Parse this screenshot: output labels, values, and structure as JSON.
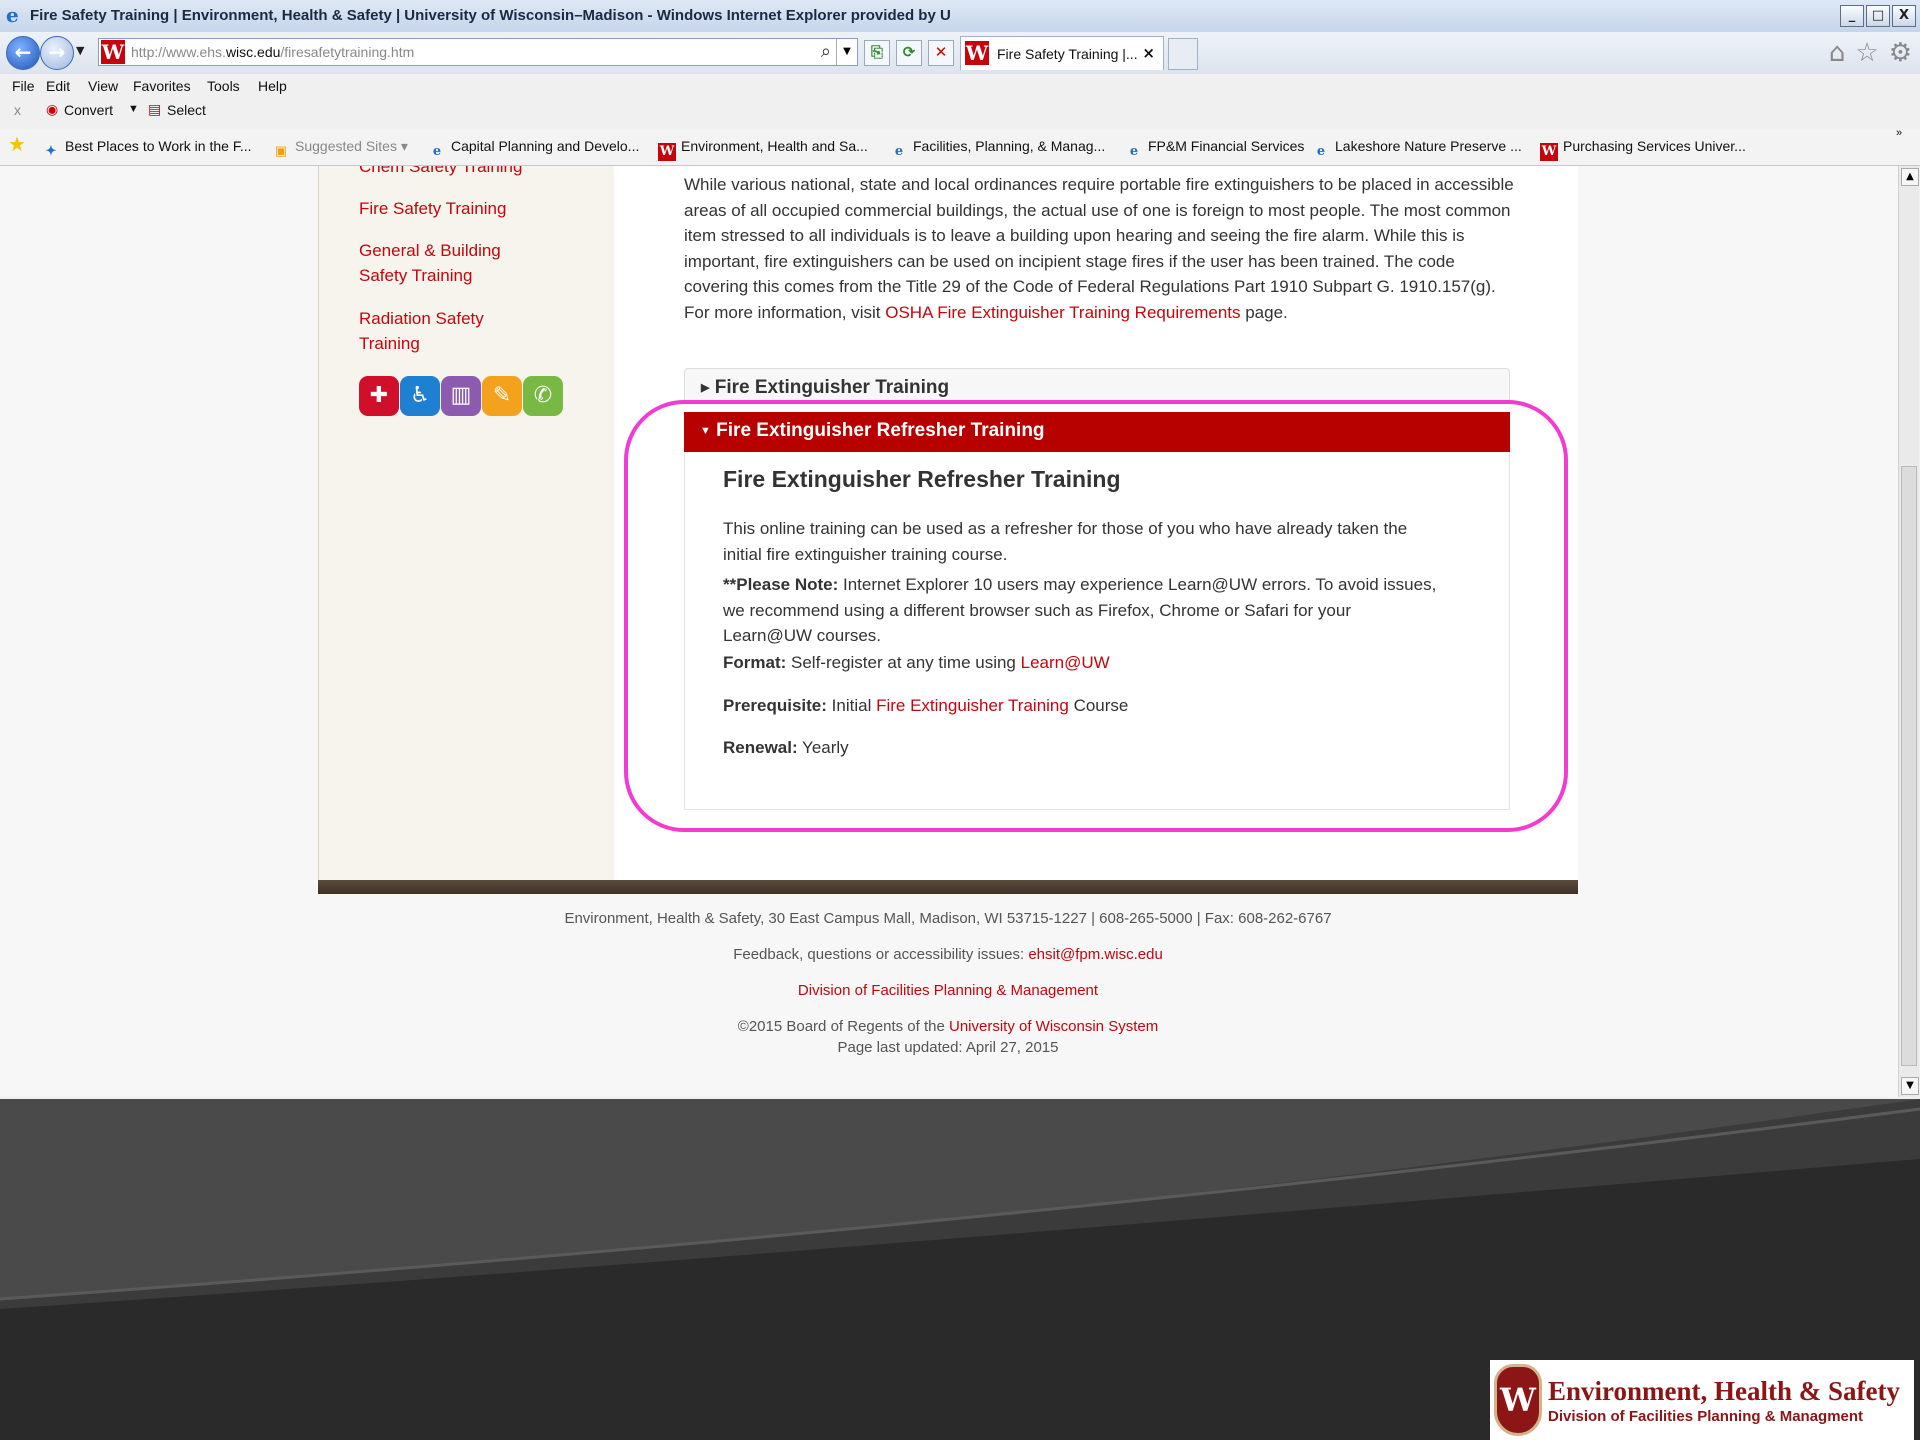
{
  "window": {
    "title": "Fire Safety Training | Environment, Health & Safety | University of Wisconsin–Madison - Windows Internet Explorer provided by U",
    "controls": [
      "_",
      "□",
      "X"
    ]
  },
  "address_bar": {
    "url_prefix": "http://www.ehs.",
    "url_domain": "wisc.edu",
    "url_path": "/firesafetytraining.htm"
  },
  "tab": {
    "title": "Fire Safety Training |...",
    "close": "×"
  },
  "menu": [
    "File",
    "Edit",
    "View",
    "Favorites",
    "Tools",
    "Help"
  ],
  "command_bar": {
    "close": "x",
    "convert": "Convert",
    "select": "Select"
  },
  "favorites": [
    {
      "icon": "ie",
      "label": "Best Places to Work in the F..."
    },
    {
      "icon": "sugg",
      "label": "Suggested Sites ▾"
    },
    {
      "icon": "ie",
      "label": "Capital Planning and Develo..."
    },
    {
      "icon": "w",
      "label": "Environment, Health and Sa..."
    },
    {
      "icon": "ie",
      "label": "Facilities, Planning, & Manag..."
    },
    {
      "icon": "ie",
      "label": "FP&M Financial Services"
    },
    {
      "icon": "ie",
      "label": "Lakeshore Nature Preserve ..."
    },
    {
      "icon": "w",
      "label": "Purchasing Services  Univer..."
    }
  ],
  "sidebar": {
    "links": [
      "Chem Safety Training",
      "Fire Safety Training",
      "General & Building Safety Training",
      "Radiation Safety Training"
    ],
    "quick_icons": [
      {
        "name": "first-aid-icon",
        "glyph": "✚",
        "color": "#d0102a"
      },
      {
        "name": "person-icon",
        "glyph": "♿",
        "color": "#1f7fd0"
      },
      {
        "name": "trash-icon",
        "glyph": "🗑",
        "color": "#8c5bb0"
      },
      {
        "name": "note-icon",
        "glyph": "✎",
        "color": "#f4a21d"
      },
      {
        "name": "phone-icon",
        "glyph": "✆",
        "color": "#78b944"
      }
    ]
  },
  "content": {
    "intro": "While various national, state and local ordinances require portable fire extinguishers to be placed in accessible areas of all occupied commercial buildings, the actual use of one is foreign to most people. The most common item stressed to all individuals is to leave a building upon hearing and seeing the fire alarm. While this is important, fire extinguishers can be used on incipient stage fires if the user has been trained. The code covering this comes from the Title 29 of the Code of Federal Regulations Part 1910 Subpart G. 1910.157(g). For more information, visit ",
    "intro_link": "OSHA Fire Extinguisher Training Requirements",
    "intro_end": " page.",
    "accordion_collapsed": "Fire Extinguisher Training",
    "accordion_open": "Fire Extinguisher Refresher Training",
    "panel_heading": "Fire Extinguisher Refresher Training",
    "panel_p1": "This online training can be used as a refresher for those of you who have already taken the initial fire extinguisher training course.",
    "note_label": "**Please Note:",
    "note_text": " Internet Explorer 10 users may experience Learn@UW errors. To avoid issues, we recommend using a different browser such as Firefox, Chrome or Safari for your Learn@UW courses.",
    "format_label": "Format:",
    "format_text": " Self-register at any time using ",
    "format_link": "Learn@UW",
    "prereq_label": "Prerequisite:",
    "prereq_text": " Initial ",
    "prereq_link": "Fire Extinguisher Training",
    "prereq_end": " Course",
    "renewal_label": "Renewal:",
    "renewal_text": " Yearly"
  },
  "footer": {
    "address": "Environment, Health & Safety, 30 East Campus Mall, Madison, WI 53715-1227 | 608-265-5000 | Fax: 608-262-6767",
    "feedback": "Feedback, questions or accessibility issues: ",
    "email": "ehsit@fpm.wisc.edu",
    "division": "Division of Facilities Planning & Management",
    "copyright": "©2015 Board of Regents of the ",
    "uw_system": "University of Wisconsin System",
    "updated": "Page last updated: April 27, 2015"
  },
  "branding": {
    "title": "Environment, Health & Safety",
    "subtitle": "Division of Facilities Planning & Managment",
    "crest_letter": "W"
  },
  "colors": {
    "uw_red": "#c5050c",
    "accordion_active": "#b70101",
    "highlight": "#f23bd1"
  }
}
